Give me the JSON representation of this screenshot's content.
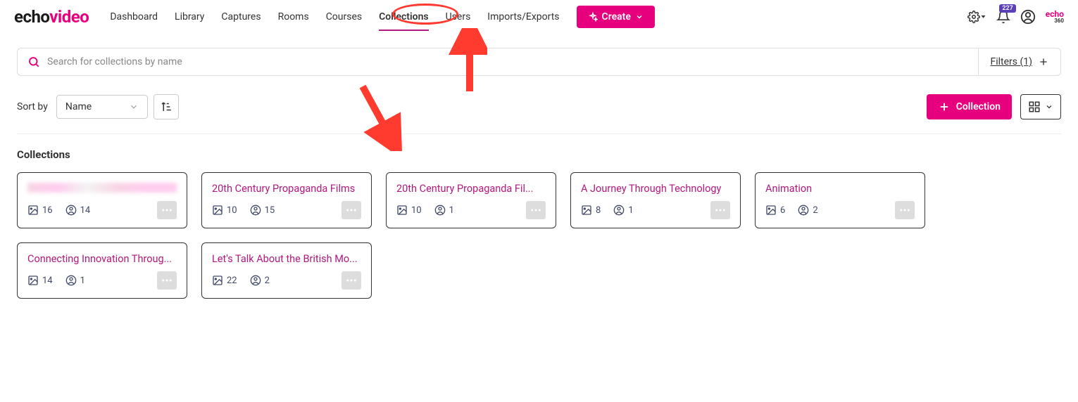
{
  "logo": {
    "part1": "echo",
    "part2": "video"
  },
  "nav": [
    "Dashboard",
    "Library",
    "Captures",
    "Rooms",
    "Courses",
    "Collections",
    "Users",
    "Imports/Exports"
  ],
  "active_nav_index": 5,
  "create_label": "Create",
  "notification_count": "227",
  "sub_logo": {
    "main": "echo",
    "suffix": "360"
  },
  "search": {
    "placeholder": "Search for collections by name"
  },
  "filters_label": "Filters (1)",
  "sort": {
    "label": "Sort by",
    "value": "Name"
  },
  "add_collection_label": "Collection",
  "section_title": "Collections",
  "cards": [
    {
      "title": "",
      "obscured": true,
      "media": "16",
      "users": "14"
    },
    {
      "title": "20th Century Propaganda Films",
      "media": "10",
      "users": "15"
    },
    {
      "title": "20th Century Propaganda Fil...",
      "media": "10",
      "users": "1"
    },
    {
      "title": "A Journey Through Technology",
      "media": "8",
      "users": "1"
    },
    {
      "title": "Animation",
      "media": "6",
      "users": "2"
    },
    {
      "title": "Connecting Innovation Throug...",
      "media": "14",
      "users": "1"
    },
    {
      "title": "Let's Talk About the British Mo...",
      "media": "22",
      "users": "2"
    }
  ]
}
